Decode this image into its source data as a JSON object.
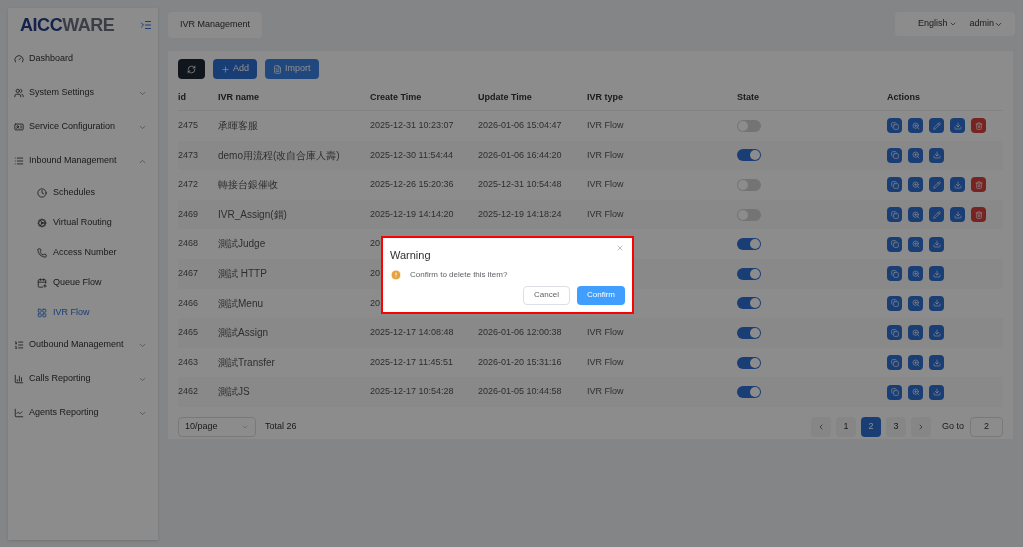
{
  "sidebar": {
    "logo": {
      "part_1": "AICC",
      "part_2": "WARE"
    },
    "items": [
      {
        "label": "Dashboard"
      },
      {
        "label": "System Settings",
        "expanded": false
      },
      {
        "label": "Service Configuration",
        "expanded": false
      },
      {
        "label": "Inbound Management",
        "expanded": true,
        "children": [
          {
            "label": "Schedules",
            "selected": false
          },
          {
            "label": "Virtual Routing",
            "selected": false
          },
          {
            "label": "Access Number",
            "selected": false
          },
          {
            "label": "Queue Flow",
            "selected": false
          },
          {
            "label": "IVR Flow",
            "selected": true
          }
        ]
      },
      {
        "label": "Outbound Management",
        "expanded": false
      },
      {
        "label": "Calls Reporting",
        "expanded": false
      },
      {
        "label": "Agents Reporting",
        "expanded": false
      }
    ]
  },
  "breadcrumb_tab": "IVR Management",
  "header": {
    "language": "English",
    "user": "admin"
  },
  "toolbar": {
    "buttons": [
      {
        "kind": "refresh"
      },
      {
        "kind": "add",
        "label": "Add"
      },
      {
        "kind": "import",
        "label": "Import"
      }
    ]
  },
  "table": {
    "columns": [
      "id",
      "IVR name",
      "Create Time",
      "Update Time",
      "IVR type",
      "State",
      "Actions"
    ],
    "rows": [
      {
        "id": "2475",
        "name": "承暉客服",
        "create": "2025-12-31 10:23:07",
        "update": "2026-01-06 15:04:47",
        "type": "IVR Flow",
        "on": false,
        "actions": [
          {
            "kind": "copy"
          },
          {
            "kind": "view"
          },
          {
            "kind": "edit"
          },
          {
            "kind": "export"
          },
          {
            "kind": "delete"
          }
        ]
      },
      {
        "id": "2473",
        "name": "demo用流程(改自合庫人壽)",
        "create": "2025-12-30 11:54:44",
        "update": "2026-01-06 16:44:20",
        "type": "IVR Flow",
        "on": true,
        "actions": [
          {
            "kind": "copy"
          },
          {
            "kind": "view"
          },
          {
            "kind": "export"
          }
        ]
      },
      {
        "id": "2472",
        "name": "轉接台銀催收",
        "create": "2025-12-26 15:20:36",
        "update": "2025-12-31 10:54:48",
        "type": "IVR Flow",
        "on": false,
        "actions": [
          {
            "kind": "copy"
          },
          {
            "kind": "view"
          },
          {
            "kind": "edit"
          },
          {
            "kind": "export"
          },
          {
            "kind": "delete"
          }
        ]
      },
      {
        "id": "2469",
        "name": "IVR_Assign(錯)",
        "create": "2025-12-19 14:14:20",
        "update": "2025-12-19 14:18:24",
        "type": "IVR Flow",
        "on": false,
        "actions": [
          {
            "kind": "copy"
          },
          {
            "kind": "view"
          },
          {
            "kind": "edit"
          },
          {
            "kind": "export"
          },
          {
            "kind": "delete"
          }
        ]
      },
      {
        "id": "2468",
        "name": "測試Judge",
        "create": "20",
        "on": true,
        "actions": [
          {
            "kind": "copy"
          },
          {
            "kind": "view"
          },
          {
            "kind": "export"
          }
        ]
      },
      {
        "id": "2467",
        "name": "測試 HTTP",
        "create": "20",
        "on": true,
        "actions": [
          {
            "kind": "copy"
          },
          {
            "kind": "view"
          },
          {
            "kind": "export"
          }
        ]
      },
      {
        "id": "2466",
        "name": "測試Menu",
        "create": "20",
        "on": true,
        "actions": [
          {
            "kind": "copy"
          },
          {
            "kind": "view"
          },
          {
            "kind": "export"
          }
        ]
      },
      {
        "id": "2465",
        "name": "測試Assign",
        "create": "2025-12-17 14:08:48",
        "update": "2026-01-06 12:00:38",
        "type": "IVR Flow",
        "on": true,
        "actions": [
          {
            "kind": "copy"
          },
          {
            "kind": "view"
          },
          {
            "kind": "export"
          }
        ]
      },
      {
        "id": "2463",
        "name": "測試Transfer",
        "create": "2025-12-17 11:45:51",
        "update": "2026-01-20 15:31:16",
        "type": "IVR Flow",
        "on": true,
        "actions": [
          {
            "kind": "copy"
          },
          {
            "kind": "view"
          },
          {
            "kind": "export"
          }
        ]
      },
      {
        "id": "2462",
        "name": "測試JS",
        "create": "2025-12-17 10:54:28",
        "update": "2026-01-05 10:44:58",
        "type": "IVR Flow",
        "on": true,
        "actions": [
          {
            "kind": "copy"
          },
          {
            "kind": "view"
          },
          {
            "kind": "export"
          }
        ]
      }
    ]
  },
  "pagination": {
    "page_size": "10/page",
    "total": "Total 26",
    "pages": [
      {
        "label": "1",
        "selected": false
      },
      {
        "label": "2",
        "selected": true
      },
      {
        "label": "3",
        "selected": false
      }
    ],
    "goto_label": "Go to",
    "goto_value": "2"
  },
  "dialog": {
    "title": "Warning",
    "message": "Confirm to delete this item?",
    "buttons": [
      {
        "kind": "cancel",
        "label": "Cancel"
      },
      {
        "kind": "confirm",
        "label": "Confirm"
      }
    ]
  }
}
